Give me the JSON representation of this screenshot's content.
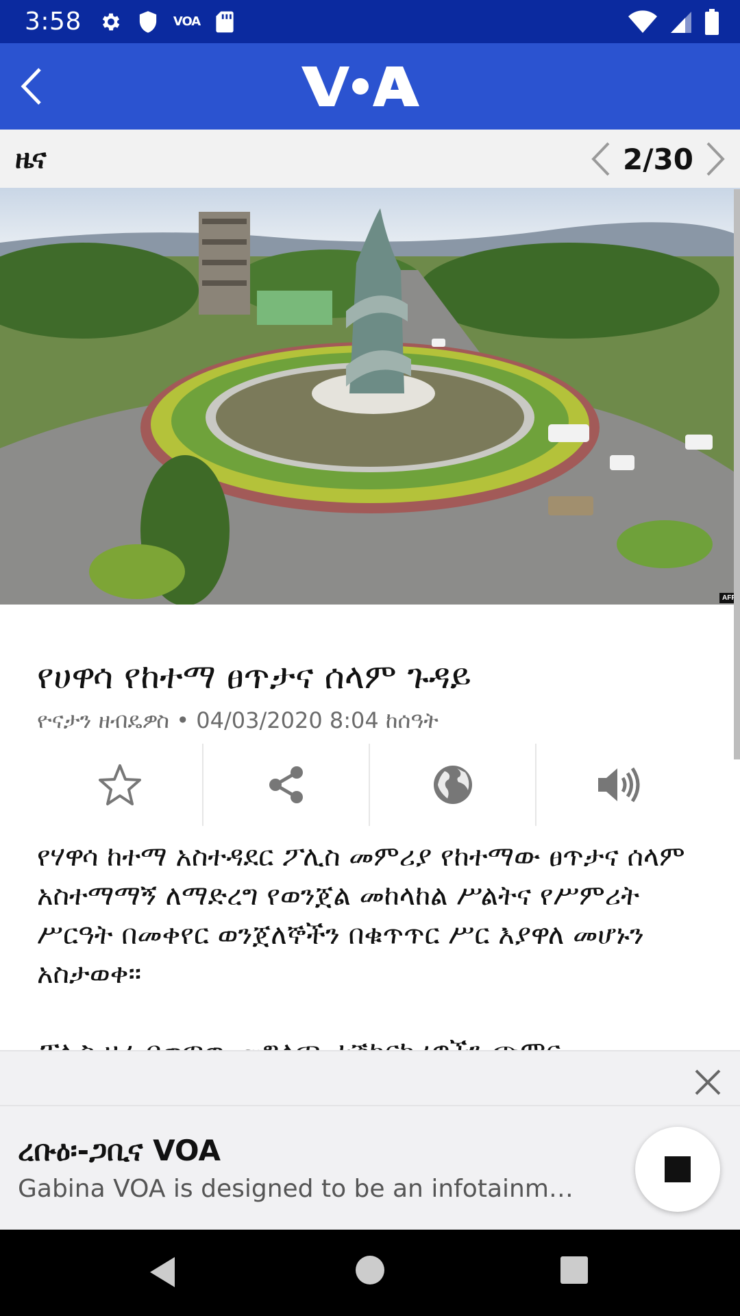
{
  "status_bar": {
    "time": "3:58",
    "voa_label": "VOA",
    "icons_left": [
      "settings-icon",
      "shield-icon",
      "voa-icon",
      "sd-card-icon"
    ],
    "icons_right": [
      "wifi-icon",
      "signal-icon",
      "battery-icon"
    ]
  },
  "app_bar": {
    "back_icon": "chevron-left-icon",
    "logo_text": "VOA",
    "brand_color": "#2b53d0"
  },
  "section": {
    "title": "ዜና",
    "pager": "2/30"
  },
  "hero": {
    "credit": "AFP"
  },
  "article": {
    "headline": "የሀዋሳ የከተማ ፀጥታና ሰላም ጉዳይ",
    "byline": "ዮናታን ዘብዴዎስ • 04/03/2020 8:04 ከሰዓት",
    "actions": [
      "star-icon",
      "share-icon",
      "globe-icon",
      "speaker-icon"
    ],
    "paragraph1": "የሃዋሳ ከተማ አስተዳደር ፖሊስ መምሪያ የከተማው ፀጥታና ሰላም አስተማማኝ ለማድረግ የወንጀል መከላከል ሥልትና የሥምሪት ሥርዓት በመቀየር ወንጀለኞችን በቁጥጥር ሥር እያዋለ መሆኑን አስታወቀ።",
    "paragraph2": "ፖሊስ ዛሬ በወጣው መግለጫ ተሽከርካሪዎችን ጭምር"
  },
  "player": {
    "title": "ረቡዕ፡-ጋቢና VOA",
    "subtitle": "Gabina VOA is designed to be an infotainm…"
  }
}
